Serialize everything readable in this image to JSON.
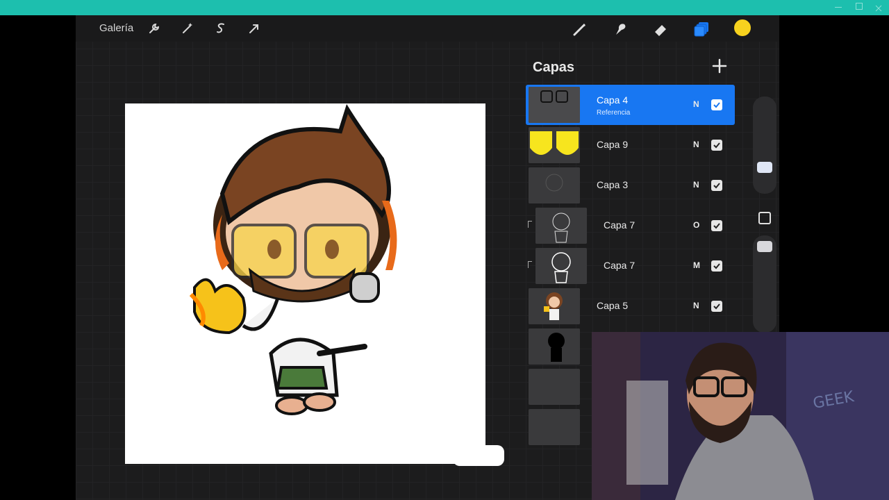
{
  "toolbar": {
    "gallery_label": "Galería",
    "tools": [
      "wrench-icon",
      "magic-wand-icon",
      "selection-icon",
      "transform-icon"
    ],
    "right_tools": [
      "brush-icon",
      "smudge-icon",
      "eraser-icon",
      "layers-icon"
    ],
    "current_color": "#f7d21e"
  },
  "layers_panel": {
    "title": "Capas",
    "add_icon": "plus-icon",
    "layers": [
      {
        "name": "Capa 4",
        "subtitle": "Referencia",
        "mode": "N",
        "visible": true,
        "selected": true
      },
      {
        "name": "Capa 9",
        "mode": "N",
        "visible": true
      },
      {
        "name": "Capa 3",
        "mode": "N",
        "visible": true
      },
      {
        "name": "Capa 7",
        "mode": "O",
        "visible": true,
        "clipped": true
      },
      {
        "name": "Capa 7",
        "mode": "M",
        "visible": true,
        "clipped": true
      },
      {
        "name": "Capa 5",
        "mode": "N",
        "visible": true
      }
    ]
  },
  "colors": {
    "accent": "#1877f2",
    "window_bar": "#1dbfae"
  }
}
